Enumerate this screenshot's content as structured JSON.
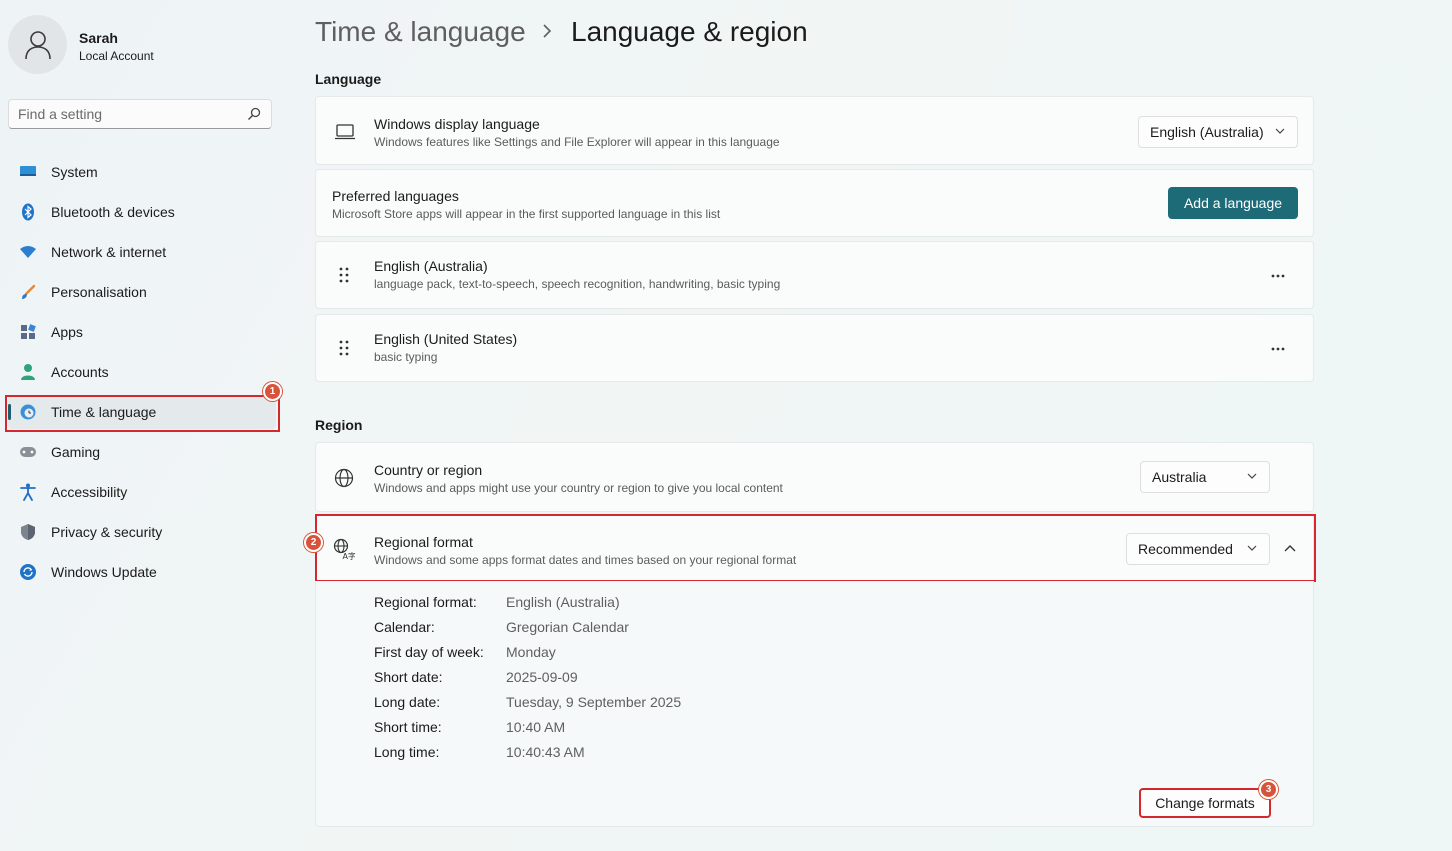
{
  "user": {
    "name": "Sarah",
    "account_type": "Local Account"
  },
  "search": {
    "placeholder": "Find a setting"
  },
  "sidebar": {
    "items": [
      {
        "label": "System"
      },
      {
        "label": "Bluetooth & devices"
      },
      {
        "label": "Network & internet"
      },
      {
        "label": "Personalisation"
      },
      {
        "label": "Apps"
      },
      {
        "label": "Accounts"
      },
      {
        "label": "Time & language"
      },
      {
        "label": "Gaming"
      },
      {
        "label": "Accessibility"
      },
      {
        "label": "Privacy & security"
      },
      {
        "label": "Windows Update"
      }
    ],
    "active_index": 6
  },
  "breadcrumb": {
    "parent": "Time & language",
    "current": "Language & region"
  },
  "language": {
    "section_title": "Language",
    "display_language": {
      "title": "Windows display language",
      "description": "Windows features like Settings and File Explorer will appear in this language",
      "value": "English (Australia)"
    },
    "preferred": {
      "title": "Preferred languages",
      "description": "Microsoft Store apps will appear in the first supported language in this list",
      "button_label": "Add a language"
    },
    "languages": [
      {
        "name": "English (Australia)",
        "features": "language pack, text-to-speech, speech recognition, handwriting, basic typing"
      },
      {
        "name": "English (United States)",
        "features": "basic typing"
      }
    ]
  },
  "region": {
    "section_title": "Region",
    "country": {
      "title": "Country or region",
      "description": "Windows and apps might use your country or region to give you local content",
      "value": "Australia"
    },
    "regional_format": {
      "title": "Regional format",
      "description": "Windows and some apps format dates and times based on your regional format",
      "value": "Recommended",
      "details": [
        {
          "label": "Regional format:",
          "value": "English (Australia)"
        },
        {
          "label": "Calendar:",
          "value": "Gregorian Calendar"
        },
        {
          "label": "First day of week:",
          "value": "Monday"
        },
        {
          "label": "Short date:",
          "value": "2025-09-09"
        },
        {
          "label": "Long date:",
          "value": "Tuesday, 9 September 2025"
        },
        {
          "label": "Short time:",
          "value": "10:40 AM"
        },
        {
          "label": "Long time:",
          "value": "10:40:43 AM"
        }
      ],
      "change_button": "Change formats"
    }
  },
  "annotations": {
    "badge_1": "1",
    "badge_2": "2",
    "badge_3": "3"
  },
  "colors": {
    "accent": "#1e6b78",
    "highlight": "#d4272e",
    "badge": "#d9533a"
  }
}
